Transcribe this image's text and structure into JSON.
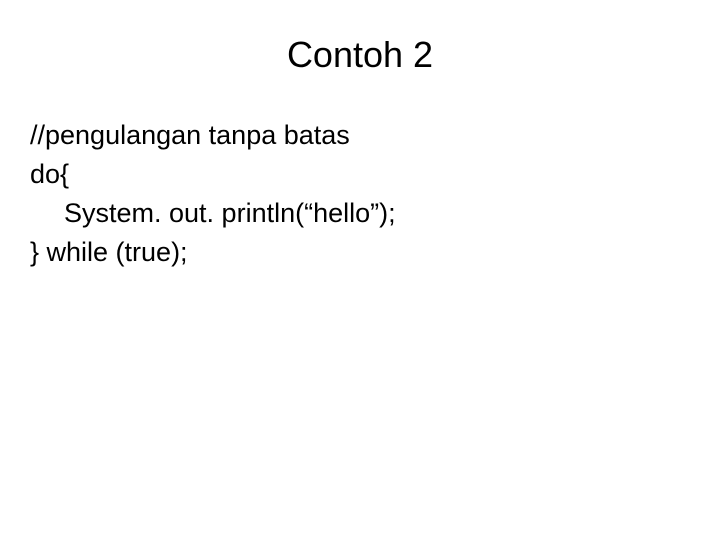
{
  "title": "Contoh 2",
  "code": {
    "line1": "//pengulangan tanpa batas",
    "line2": "do{",
    "line3": "System. out. println(“hello”);",
    "line4": "} while (true);"
  }
}
